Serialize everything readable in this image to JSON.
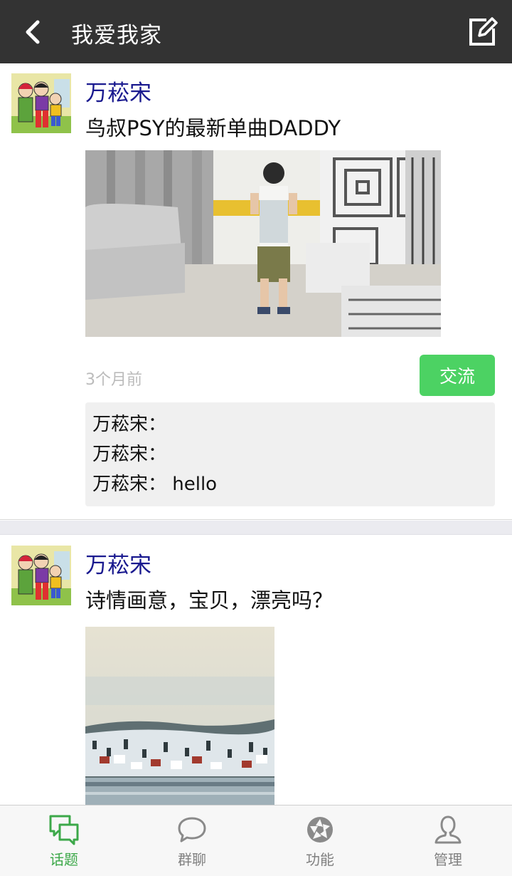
{
  "header": {
    "title": "我爱我家"
  },
  "posts": [
    {
      "author": "万菘宋",
      "text": "鸟叔PSY的最新单曲DADDY",
      "time": "3个月前",
      "reply_label": "交流",
      "comments": [
        {
          "text": "万菘宋："
        },
        {
          "text": "万菘宋："
        },
        {
          "text": "万菘宋： hello"
        }
      ]
    },
    {
      "author": "万菘宋",
      "text": "诗情画意，宝贝，漂亮吗？"
    }
  ],
  "tabs": [
    {
      "label": "话题",
      "icon": "chat-bubbles-icon",
      "active": true
    },
    {
      "label": "群聊",
      "icon": "speech-bubble-icon",
      "active": false
    },
    {
      "label": "功能",
      "icon": "aperture-icon",
      "active": false
    },
    {
      "label": "管理",
      "icon": "person-icon",
      "active": false
    }
  ],
  "colors": {
    "header_bg": "#333333",
    "accent_green": "#4cd263",
    "author_blue": "#1a1a8f",
    "tab_active": "#3ca849"
  }
}
